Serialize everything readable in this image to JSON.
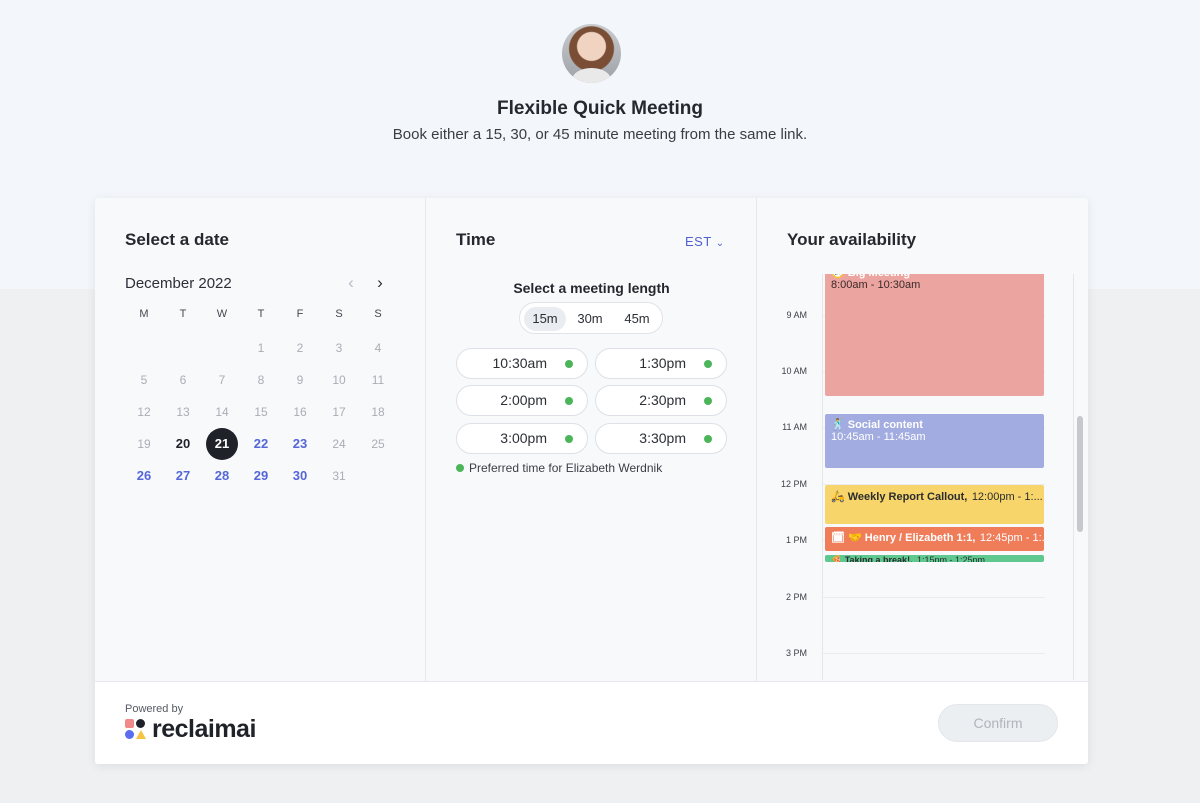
{
  "header": {
    "title": "Flexible Quick Meeting",
    "subtitle": "Book either a 15, 30, or 45 minute meeting from the same link."
  },
  "date_section": {
    "title": "Select a date",
    "month": "December 2022",
    "weekdays": [
      "M",
      "T",
      "W",
      "T",
      "F",
      "S",
      "S"
    ],
    "weeks": [
      [
        {
          "d": "",
          "s": "empty"
        },
        {
          "d": "",
          "s": "empty"
        },
        {
          "d": "",
          "s": "empty"
        },
        {
          "d": "1",
          "s": "past"
        },
        {
          "d": "2",
          "s": "past"
        },
        {
          "d": "3",
          "s": "past"
        },
        {
          "d": "4",
          "s": "past"
        }
      ],
      [
        {
          "d": "5",
          "s": "past"
        },
        {
          "d": "6",
          "s": "past"
        },
        {
          "d": "7",
          "s": "past"
        },
        {
          "d": "8",
          "s": "past"
        },
        {
          "d": "9",
          "s": "past"
        },
        {
          "d": "10",
          "s": "past"
        },
        {
          "d": "11",
          "s": "past"
        }
      ],
      [
        {
          "d": "12",
          "s": "past"
        },
        {
          "d": "13",
          "s": "past"
        },
        {
          "d": "14",
          "s": "past"
        },
        {
          "d": "15",
          "s": "past"
        },
        {
          "d": "16",
          "s": "past"
        },
        {
          "d": "17",
          "s": "past"
        },
        {
          "d": "18",
          "s": "past"
        }
      ],
      [
        {
          "d": "19",
          "s": "past"
        },
        {
          "d": "20",
          "s": "today"
        },
        {
          "d": "21",
          "s": "selected"
        },
        {
          "d": "22",
          "s": "avail"
        },
        {
          "d": "23",
          "s": "avail"
        },
        {
          "d": "24",
          "s": "past"
        },
        {
          "d": "25",
          "s": "past"
        }
      ],
      [
        {
          "d": "26",
          "s": "avail"
        },
        {
          "d": "27",
          "s": "avail"
        },
        {
          "d": "28",
          "s": "avail"
        },
        {
          "d": "29",
          "s": "avail"
        },
        {
          "d": "30",
          "s": "avail"
        },
        {
          "d": "31",
          "s": "past"
        },
        {
          "d": "",
          "s": "empty"
        }
      ]
    ]
  },
  "time_section": {
    "title": "Time",
    "timezone": "EST",
    "length_label": "Select a meeting length",
    "lengths": [
      "15m",
      "30m",
      "45m"
    ],
    "selected_length": "15m",
    "slots": [
      "10:30am",
      "1:30pm",
      "2:00pm",
      "2:30pm",
      "3:00pm",
      "3:30pm"
    ],
    "legend": "Preferred time for Elizabeth Werdnik"
  },
  "availability": {
    "title": "Your availability",
    "hours": [
      "9 AM",
      "10 AM",
      "11 AM",
      "12 PM",
      "1 PM",
      "2 PM",
      "3 PM"
    ],
    "events": [
      {
        "name": "🧭 Big Meeting",
        "time": "8:00am - 10:30am",
        "color": "#eba49f"
      },
      {
        "name": "🕺 Social content",
        "time": "10:45am - 11:45am",
        "color": "#a2ace0"
      },
      {
        "name": "🛵 Weekly Report Callout,",
        "time": "12:00pm - 1:...",
        "color": "#f7d56a",
        "dark": true
      },
      {
        "name": "🗓 🤝 Henry / Elizabeth 1:1,",
        "time": "12:45pm - 1:...",
        "color": "#f07d5a"
      },
      {
        "name": "🍕 Taking a break!,",
        "time": "1:15pm - 1:25pm",
        "color": "#5fc88e",
        "dark": true
      }
    ]
  },
  "footer": {
    "powered_by": "Powered by",
    "brand": "reclaimai",
    "confirm": "Confirm"
  },
  "colors": {
    "accent": "#5566d8",
    "available_dot": "#4cb55a",
    "selected_day": "#1f2329"
  }
}
